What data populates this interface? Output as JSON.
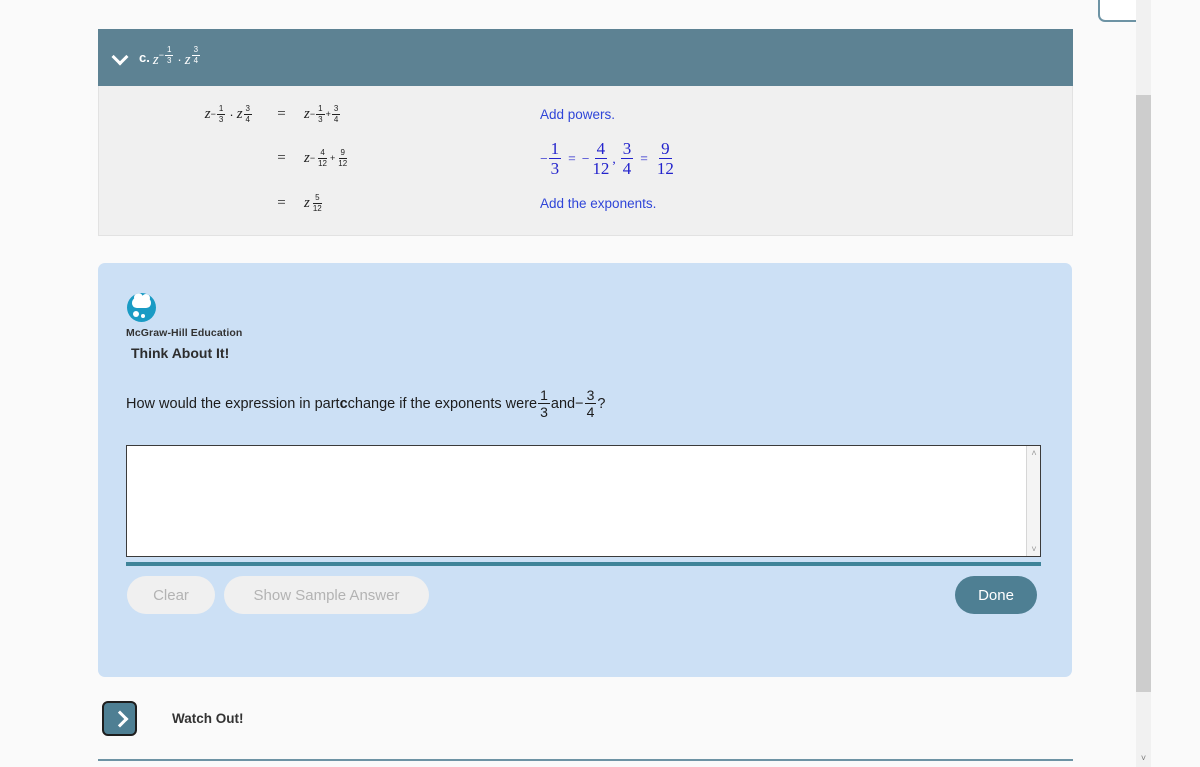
{
  "worked_example": {
    "header": {
      "chevron_icon": "chevron-down-icon",
      "part_label": "c.",
      "expression": {
        "base": "z",
        "exp1_sign": "−",
        "exp1_num": "1",
        "exp1_den": "3",
        "operator": "·",
        "exp2_num": "3",
        "exp2_den": "4"
      }
    },
    "rows": [
      {
        "lhs": {
          "base": "z",
          "exp1_sign": "−",
          "exp1_num": "1",
          "exp1_den": "3",
          "operator": "·",
          "exp2_num": "3",
          "exp2_den": "4"
        },
        "equals": "=",
        "rhs": {
          "base": "z",
          "sign": "−",
          "f1_num": "1",
          "f1_den": "3",
          "plus": "+",
          "f2_num": "3",
          "f2_den": "4"
        },
        "note": "Add powers.",
        "note_type": "text"
      },
      {
        "equals": "=",
        "rhs": {
          "base": "z",
          "sign": "−",
          "f1_num": "4",
          "f1_den": "12",
          "plus": "+",
          "f2_num": "9",
          "f2_den": "12"
        },
        "note_type": "math",
        "note_math": {
          "lead_sign": "−",
          "a_num": "1",
          "a_den": "3",
          "eq1": "=",
          "mid_sign": "−",
          "b_num": "4",
          "b_den": "12",
          "comma": ",",
          "c_num": "3",
          "c_den": "4",
          "eq2": "=",
          "d_num": "9",
          "d_den": "12"
        }
      },
      {
        "equals": "=",
        "rhs_simple": {
          "base": "z",
          "f_num": "5",
          "f_den": "12"
        },
        "note": "Add the exponents.",
        "note_type": "text"
      }
    ]
  },
  "think_about_it": {
    "logo_icon": "mcgraw-hill-thought-bubble-icon",
    "brand": "McGraw-Hill Education",
    "title": "Think About It!",
    "question": {
      "part1": "How would the expression in part ",
      "bold_part": "c",
      "part2": " change if the exponents were ",
      "frac1_num": "1",
      "frac1_den": "3",
      "conjunction": " and ",
      "minus": "−",
      "frac2_num": "3",
      "frac2_den": "4",
      "question_mark": "?"
    },
    "answer": {
      "value": "",
      "placeholder": "",
      "scroll_up_icon": "˄",
      "scroll_down_icon": "˅"
    },
    "buttons": {
      "clear": "Clear",
      "show_sample_answer": "Show Sample Answer",
      "done": "Done"
    }
  },
  "watch_out": {
    "icon": "chevron-right-icon",
    "label": "Watch Out!"
  },
  "scrollbar": {
    "down_arrow_icon": "˅"
  },
  "colors": {
    "header_bar": "#5d8293",
    "panel_bg": "#cce0f5",
    "work_bg": "#f0f0f0",
    "note_blue": "#2f45d8",
    "done_button": "#4e7f93",
    "divider_teal": "#3f8499",
    "logo_blue": "#1a9bc4"
  }
}
